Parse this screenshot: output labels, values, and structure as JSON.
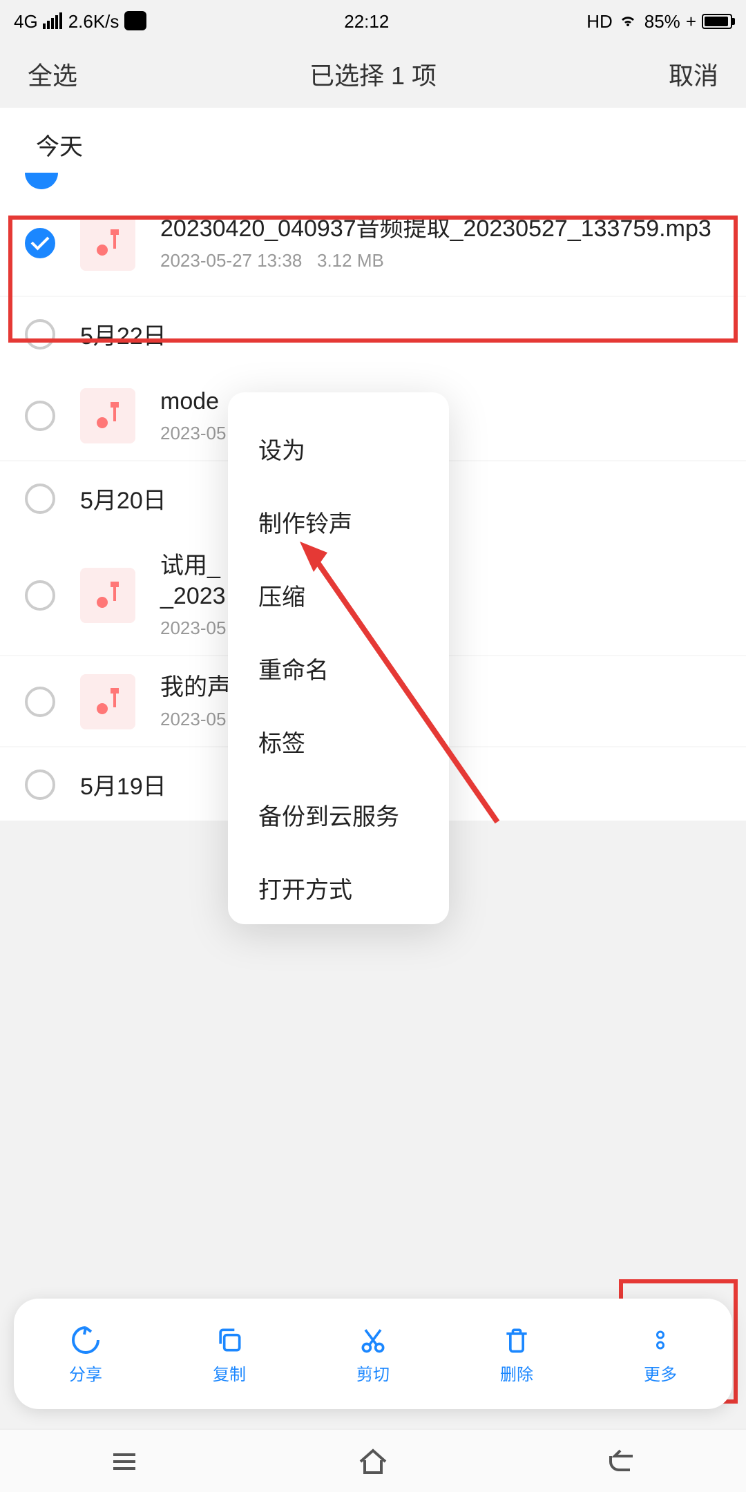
{
  "status": {
    "net": "4G",
    "speed": "2.6K/s",
    "time": "22:12",
    "hd": "HD",
    "battery": "85%",
    "charge": "+"
  },
  "header": {
    "select_all": "全选",
    "title": "已选择 1 项",
    "cancel": "取消"
  },
  "section_today": "今天",
  "files": [
    {
      "name": "20230420_040937音频提取_20230527_133759.mp3",
      "date": "2023-05-27 13:38",
      "size": "3.12 MB",
      "checked": true
    },
    {
      "name": "mode",
      "date": "2023-05",
      "size": "",
      "checked": false
    },
    {
      "name": "试用_\n_2023",
      "date": "2023-05",
      "size": "",
      "checked": false
    },
    {
      "name": "我的声",
      "date": "2023-05",
      "size": "",
      "checked": false
    }
  ],
  "dates": {
    "d1": "5月22日",
    "d2": "5月20日",
    "d3": "5月19日"
  },
  "menu": {
    "m0": "设为",
    "m1": "制作铃声",
    "m2": "压缩",
    "m3": "重命名",
    "m4": "标签",
    "m5": "备份到云服务",
    "m6": "打开方式"
  },
  "toolbar": {
    "share": "分享",
    "copy": "复制",
    "cut": "剪切",
    "delete": "删除",
    "more": "更多"
  }
}
